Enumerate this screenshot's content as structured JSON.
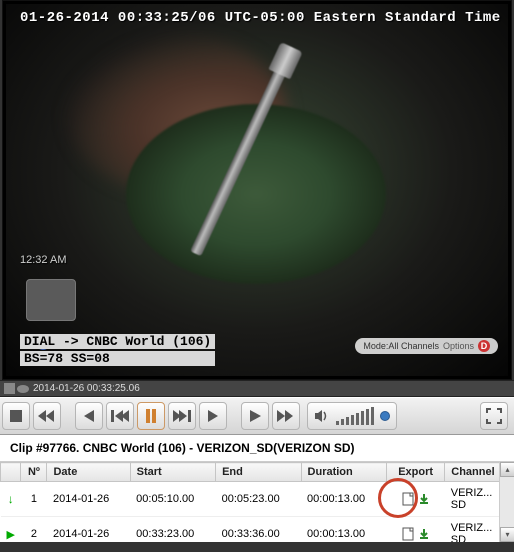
{
  "video": {
    "timestamp_overlay": "01-26-2014 00:33:25/06 UTC-05:00 Eastern Standard Time",
    "clock": "12:32 AM",
    "mode_label": "Mode:All Channels",
    "options_label": "Options",
    "osd_line1": "DIAL -> CNBC World (106)",
    "osd_line2": "BS=78 SS=08"
  },
  "timeline": {
    "label": "2014-01-26 00:33:25.06"
  },
  "clip": {
    "title": "Clip #97766. CNBC World (106) - VERIZON_SD(VERIZON SD)"
  },
  "table": {
    "headers": {
      "num": "Nº",
      "date": "Date",
      "start": "Start",
      "end": "End",
      "duration": "Duration",
      "export": "Export",
      "channel": "Channel"
    },
    "rows": [
      {
        "num": "1",
        "date": "2014-01-26",
        "start": "00:05:10.00",
        "end": "00:05:23.00",
        "duration": "00:00:13.00",
        "channel": "VERIZ...SD",
        "indicator": "down"
      },
      {
        "num": "2",
        "date": "2014-01-26",
        "start": "00:33:23.00",
        "end": "00:33:36.00",
        "duration": "00:00:13.00",
        "channel": "VERIZ...SD",
        "indicator": "play"
      }
    ]
  }
}
